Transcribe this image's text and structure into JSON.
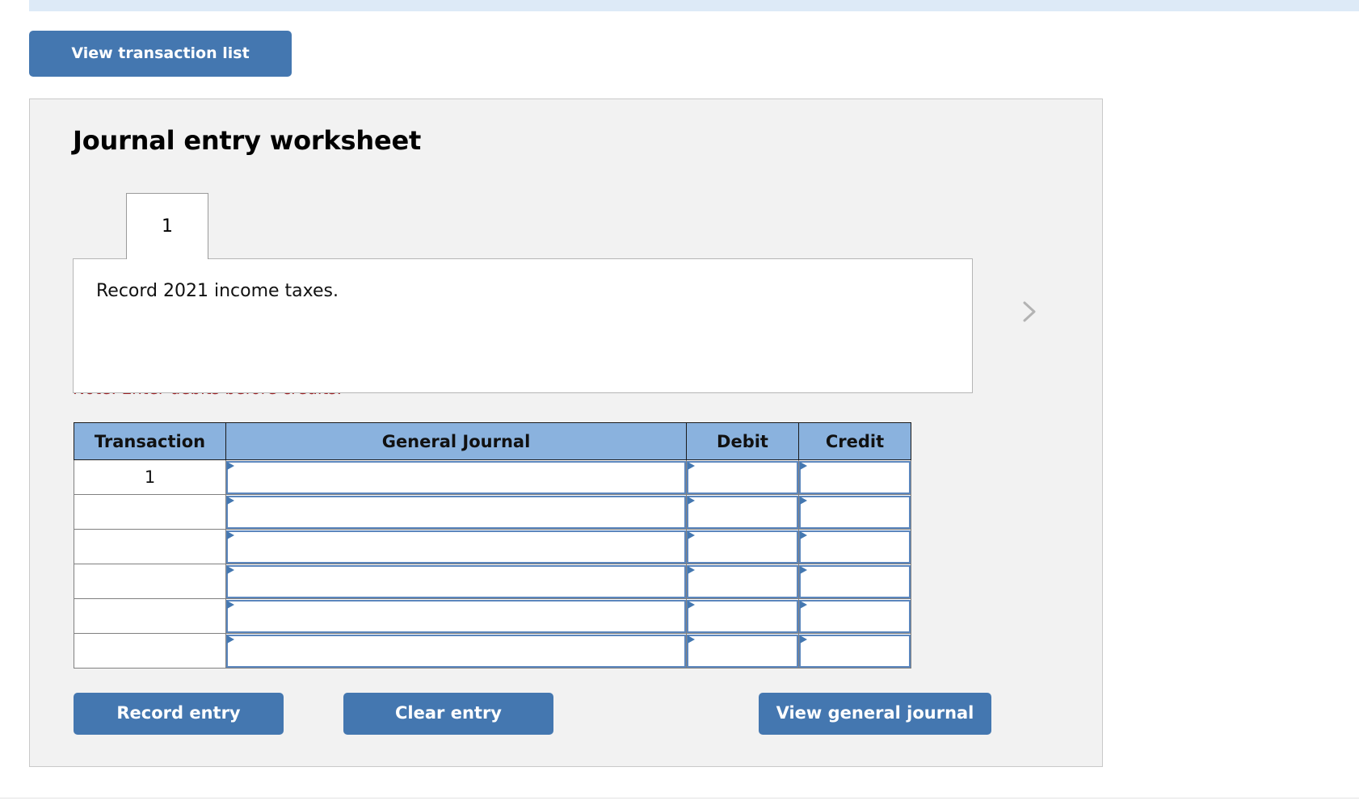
{
  "toolbar": {
    "view_transaction_list_label": "View transaction list"
  },
  "panel": {
    "title": "Journal entry worksheet",
    "tabs": [
      {
        "label": "1",
        "active": true
      }
    ],
    "nav": {
      "prev_icon": "chevron-left-icon",
      "next_icon": "chevron-right-icon"
    },
    "description": "Record 2021 income taxes.",
    "note": "Note: Enter debits before credits."
  },
  "journal_table": {
    "columns": [
      "Transaction",
      "General Journal",
      "Debit",
      "Credit"
    ],
    "rows": [
      {
        "transaction": "1",
        "general_journal": "",
        "debit": "",
        "credit": ""
      },
      {
        "transaction": "",
        "general_journal": "",
        "debit": "",
        "credit": ""
      },
      {
        "transaction": "",
        "general_journal": "",
        "debit": "",
        "credit": ""
      },
      {
        "transaction": "",
        "general_journal": "",
        "debit": "",
        "credit": ""
      },
      {
        "transaction": "",
        "general_journal": "",
        "debit": "",
        "credit": ""
      },
      {
        "transaction": "",
        "general_journal": "",
        "debit": "",
        "credit": ""
      }
    ]
  },
  "actions": {
    "record_entry_label": "Record entry",
    "clear_entry_label": "Clear entry",
    "view_general_journal_label": "View general journal"
  },
  "colors": {
    "accent_blue": "#4477b0",
    "header_blue": "#8ab2de",
    "strip_blue": "#ddeaf7",
    "panel_grey": "#f2f2f2",
    "note_red": "#9d2226",
    "field_border_blue": "#5b86bd"
  }
}
